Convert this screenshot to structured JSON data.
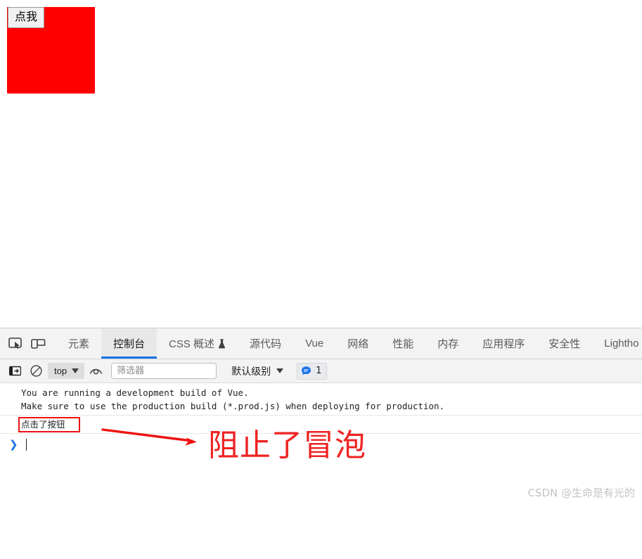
{
  "page": {
    "button_label": "点我",
    "box_color": "#ff0000"
  },
  "devtools": {
    "toolbar_icons": [
      {
        "name": "inspect-element-icon",
        "title": "检查元素"
      },
      {
        "name": "device-toolbar-icon",
        "title": "切换设备工具栏"
      }
    ],
    "tabs": [
      {
        "label": "元素",
        "active": false,
        "icon": ""
      },
      {
        "label": "控制台",
        "active": true,
        "icon": ""
      },
      {
        "label": "CSS 概述",
        "active": false,
        "icon": "flask-icon"
      },
      {
        "label": "源代码",
        "active": false,
        "icon": ""
      },
      {
        "label": "Vue",
        "active": false,
        "icon": ""
      },
      {
        "label": "网络",
        "active": false,
        "icon": ""
      },
      {
        "label": "性能",
        "active": false,
        "icon": ""
      },
      {
        "label": "内存",
        "active": false,
        "icon": ""
      },
      {
        "label": "应用程序",
        "active": false,
        "icon": ""
      },
      {
        "label": "安全性",
        "active": false,
        "icon": ""
      },
      {
        "label": "Lightho",
        "active": false,
        "icon": ""
      }
    ],
    "console_toolbar": {
      "sidebar_icon": "show-console-sidebar-icon",
      "clear_icon": "clear-console-icon",
      "context_value": "top",
      "eye_icon": "live-expression-icon",
      "filter_placeholder": "筛选器",
      "filter_value": "",
      "level_label": "默认级别",
      "badge_icon": "message-bubble-icon",
      "badge_count": "1",
      "accent_color": "#1a73e8"
    },
    "console_messages": [
      {
        "type": "group",
        "lines": [
          "You are running a development build of Vue.",
          "Make sure to use the production build (*.prod.js) when deploying for production."
        ]
      },
      {
        "type": "log",
        "lines": [
          "点击了按钮"
        ]
      }
    ],
    "prompt_chevron": "❯"
  },
  "annotations": {
    "highlight_color": "#ee1111",
    "note_text": "阻止了冒泡",
    "arrow_name": "red-arrow-annotation"
  },
  "watermark": {
    "text": "CSDN @生命是有光的"
  }
}
